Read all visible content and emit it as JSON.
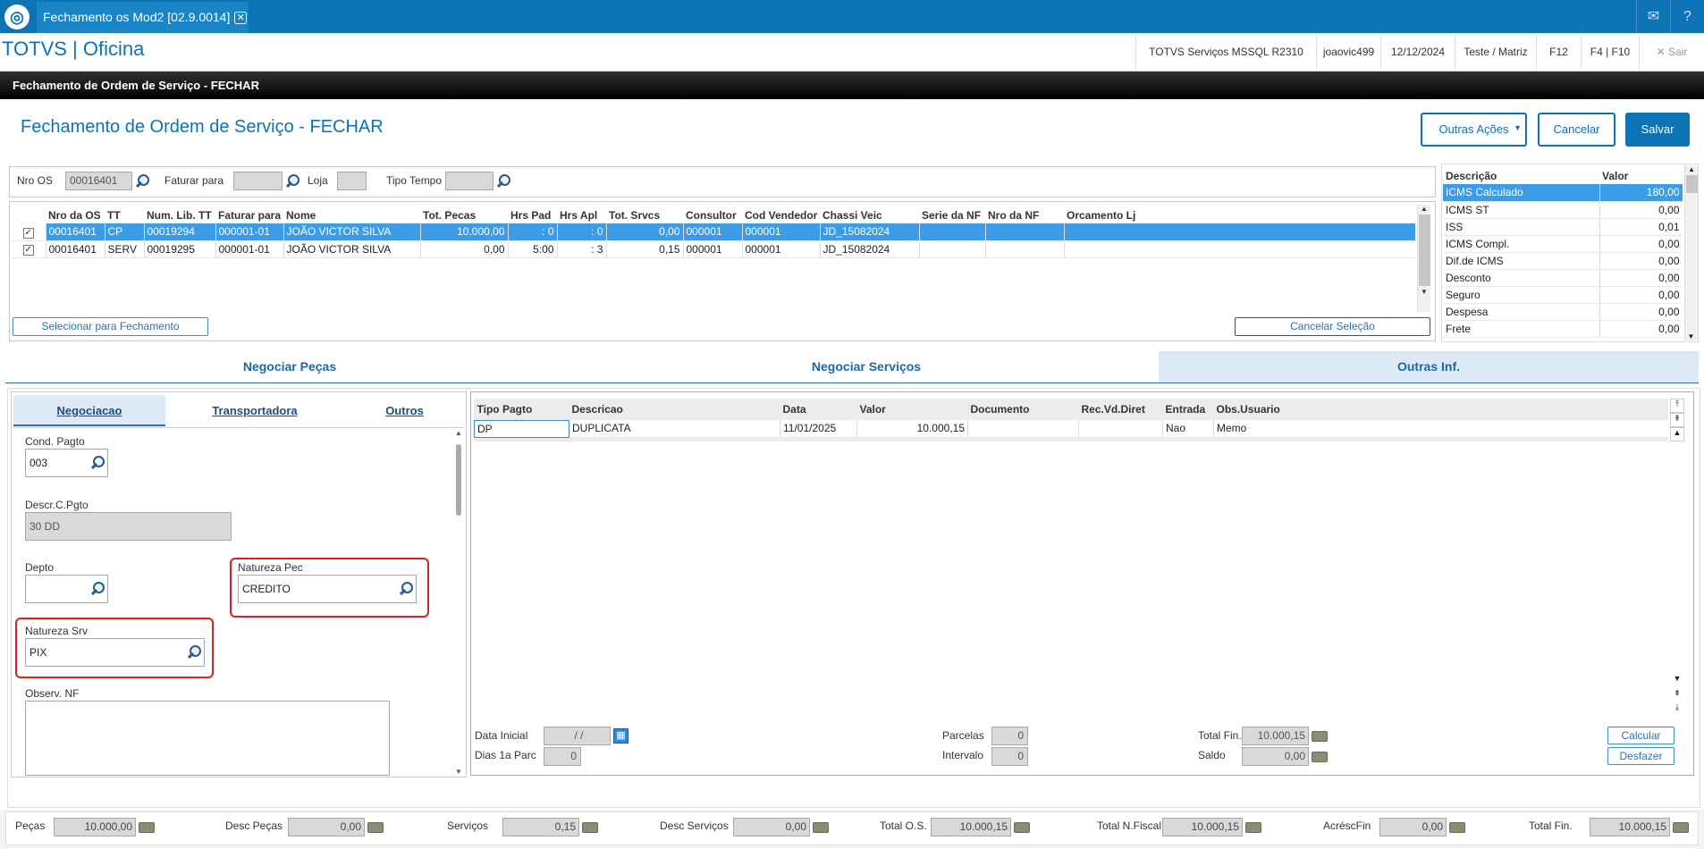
{
  "topbar": {
    "tab_title": "Fechamento os Mod2 [02.9.0014]",
    "close_glyph": "✕",
    "mail_icon": "mail-icon",
    "help_icon": "help-icon"
  },
  "app": {
    "title": "TOTVS | Oficina",
    "env": "TOTVS Serviços MSSQL R2310",
    "user": "joaovic499",
    "date": "12/12/2024",
    "branch": "Teste / Matriz",
    "f12": "F12",
    "f4f10": "F4 | F10",
    "exit": "Sair",
    "exit_glyph": "✕"
  },
  "window": {
    "title": "Fechamento de Ordem de Serviço - FECHAR"
  },
  "form": {
    "title": "Fechamento de Ordem de Serviço - FECHAR",
    "btn_outras": "Outras Ações",
    "btn_cancelar": "Cancelar",
    "btn_salvar": "Salvar"
  },
  "filter": {
    "nro_os_label": "Nro OS",
    "nro_os_value": "00016401",
    "faturar_label": "Faturar para",
    "faturar_value": "",
    "loja_label": "Loja",
    "loja_value": "",
    "tipo_tempo_label": "Tipo Tempo",
    "tipo_tempo_value": ""
  },
  "os_grid": {
    "columns": [
      "",
      "Nro da OS",
      "TT",
      "Num. Lib. TT",
      "Faturar para",
      "Nome",
      "Tot. Pecas",
      "Hrs Pad",
      "Hrs Apl",
      "Tot. Srvcs",
      "Consultor",
      "Cod Vendedor",
      "Chassi Veic",
      "Serie da NF",
      "Nro da NF",
      "Orcamento Lj"
    ],
    "rows": [
      [
        "✓",
        "00016401",
        "CP",
        "00019294",
        "000001-01",
        "JOÃO VICTOR SILVA",
        "10.000,00",
        ": 0",
        ": 0",
        "0,00",
        "000001",
        "000001",
        "JD_15082024",
        "",
        "",
        ""
      ],
      [
        "✓",
        "00016401",
        "SERV",
        "00019295",
        "000001-01",
        "JOÃO VICTOR SILVA",
        "0,00",
        "5:00",
        ": 3",
        "0,15",
        "000001",
        "000001",
        "JD_15082024",
        "",
        "",
        ""
      ]
    ],
    "btn_selecionar": "Selecionar para Fechamento",
    "btn_cancelar_sel": "Cancelar Seleção"
  },
  "taxes": {
    "col_desc": "Descrição",
    "col_valor": "Valor",
    "rows": [
      [
        "ICMS Calculado",
        "180,00"
      ],
      [
        "ICMS ST",
        "0,00"
      ],
      [
        "ISS",
        "0,01"
      ],
      [
        "ICMS Compl.",
        "0,00"
      ],
      [
        "Dif.de ICMS",
        "0,00"
      ],
      [
        "Desconto",
        "0,00"
      ],
      [
        "Seguro",
        "0,00"
      ],
      [
        "Despesa",
        "0,00"
      ],
      [
        "Frete",
        "0,00"
      ]
    ]
  },
  "main_tabs": [
    "Negociar Peças",
    "Negociar Serviços",
    "Outras Inf."
  ],
  "sub_tabs": [
    "Negociacao",
    "Transportadora",
    "Outros"
  ],
  "negociacao": {
    "cond_pagto_label": "Cond. Pagto",
    "cond_pagto_value": "003",
    "descr_label": "Descr.C.Pgto",
    "descr_value": "30 DD",
    "depto_label": "Depto",
    "depto_value": "",
    "nat_pec_label": "Natureza Pec",
    "nat_pec_value": "CREDITO",
    "nat_srv_label": "Natureza Srv",
    "nat_srv_value": "PIX",
    "observ_label": "Observ. NF",
    "observ_value": ""
  },
  "payment_grid": {
    "columns": [
      "Tipo Pagto",
      "Descricao",
      "Data",
      "Valor",
      "Documento",
      "Rec.Vd.Diret",
      "Entrada",
      "Obs.Usuario"
    ],
    "rows": [
      [
        "DP",
        "DUPLICATA",
        "11/01/2025",
        "10.000,15",
        "",
        "",
        "Nao",
        "Memo"
      ]
    ]
  },
  "payment_footer": {
    "data_inicial_label": "Data Inicial",
    "data_inicial_value": "  /  /",
    "dias_label": "Dias 1a Parc",
    "dias_value": "0",
    "parcelas_label": "Parcelas",
    "parcelas_value": "0",
    "intervalo_label": "Intervalo",
    "intervalo_value": "0",
    "total_fin_label": "Total Fin.",
    "total_fin_value": "10.000,15",
    "saldo_label": "Saldo",
    "saldo_value": "0,00",
    "btn_calcular": "Calcular",
    "btn_desfazer": "Desfazer"
  },
  "totals": {
    "pecas_label": "Peças",
    "pecas_value": "10.000,00",
    "desc_pecas_label": "Desc Peças",
    "desc_pecas_value": "0,00",
    "servicos_label": "Serviços",
    "servicos_value": "0,15",
    "desc_servicos_label": "Desc Serviços",
    "desc_servicos_value": "0,00",
    "total_os_label": "Total O.S.",
    "total_os_value": "10.000,15",
    "total_nf_label": "Total N.Fiscal",
    "total_nf_value": "10.000,15",
    "acresc_label": "AcréscFin",
    "acresc_value": "0,00",
    "total_fin_label": "Total Fin.",
    "total_fin_value": "10.000,15"
  },
  "colors": {
    "brand": "#0c74b4",
    "selection": "#3c9ce8",
    "highlight": "#e02020"
  }
}
